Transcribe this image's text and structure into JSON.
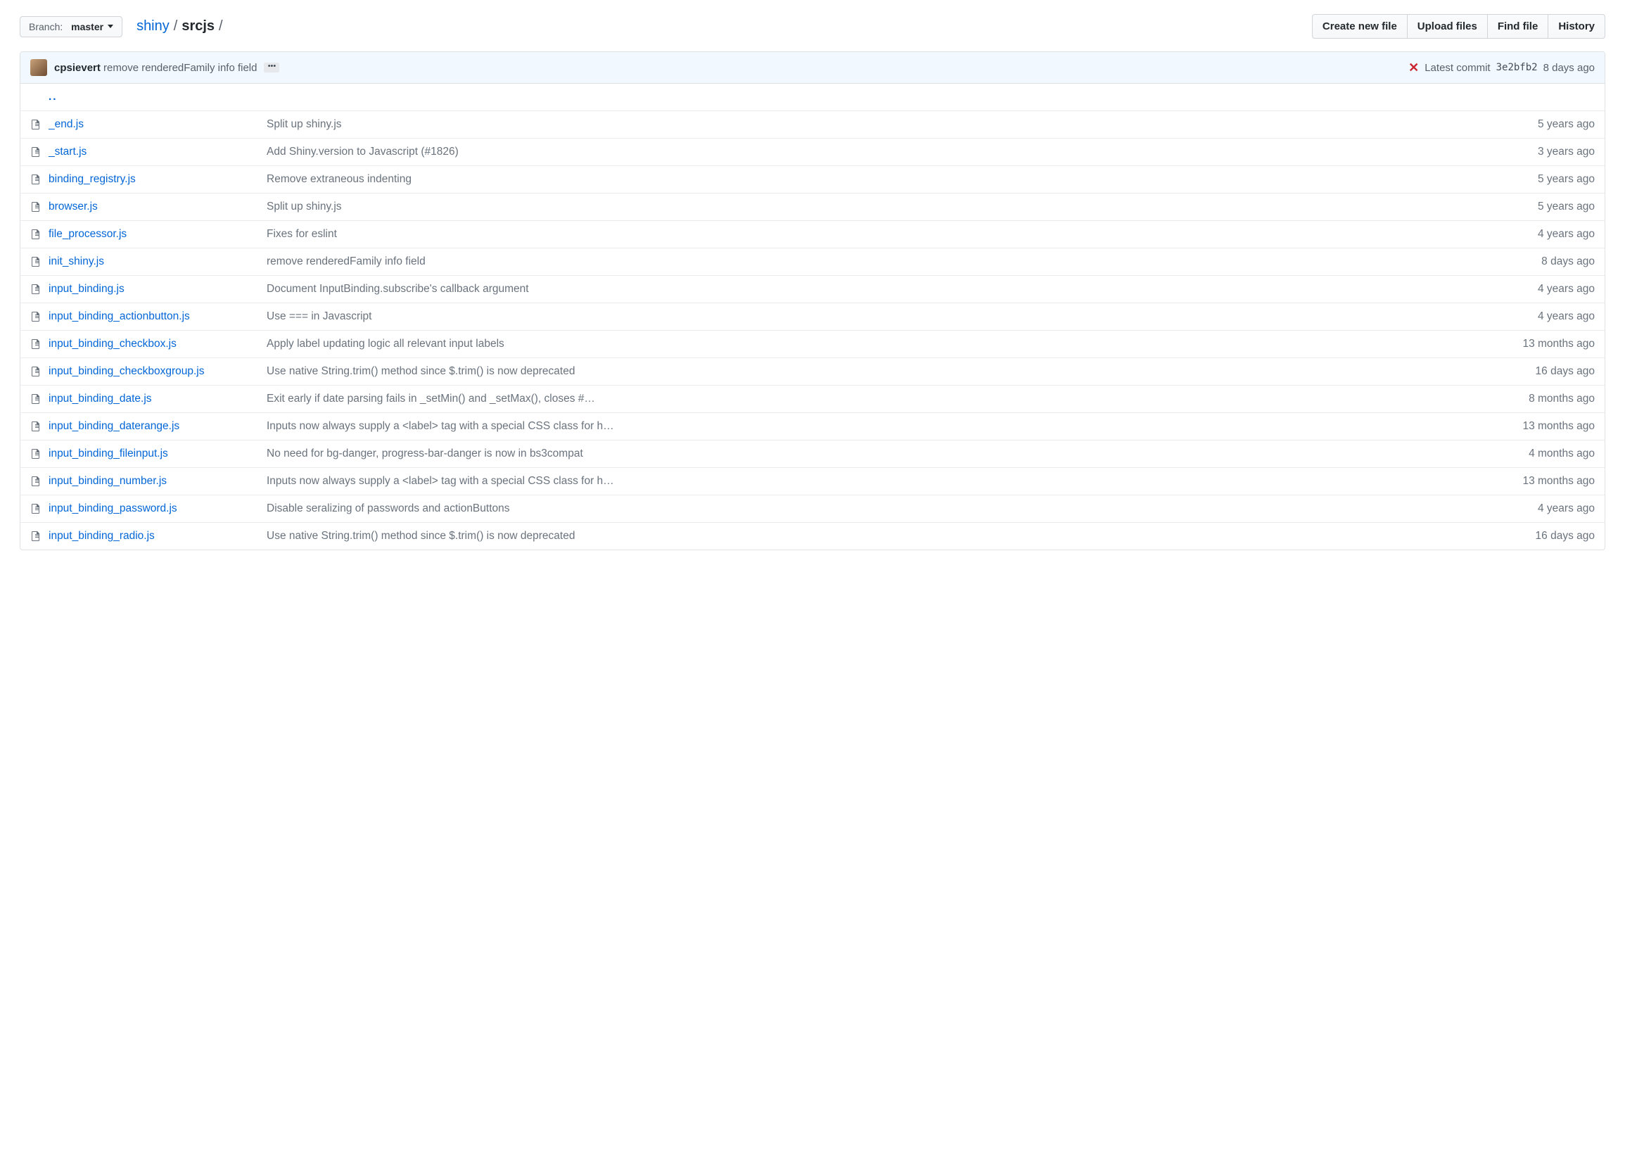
{
  "branch": {
    "label": "Branch:",
    "name": "master"
  },
  "breadcrumb": {
    "root": "shiny",
    "sep": "/",
    "current": "srcjs",
    "trail": "/"
  },
  "actions": {
    "create": "Create new file",
    "upload": "Upload files",
    "find": "Find file",
    "history": "History"
  },
  "commit_bar": {
    "author": "cpsievert",
    "message": "remove renderedFamily info field",
    "status": "failed",
    "latest_label": "Latest commit",
    "sha": "3e2bfb2",
    "age": "8 days ago"
  },
  "parent_link": "..",
  "files": [
    {
      "name": "_end.js",
      "msg": "Split up shiny.js",
      "age": "5 years ago"
    },
    {
      "name": "_start.js",
      "msg": "Add Shiny.version to Javascript (#1826)",
      "age": "3 years ago"
    },
    {
      "name": "binding_registry.js",
      "msg": "Remove extraneous indenting",
      "age": "5 years ago"
    },
    {
      "name": "browser.js",
      "msg": "Split up shiny.js",
      "age": "5 years ago"
    },
    {
      "name": "file_processor.js",
      "msg": "Fixes for eslint",
      "age": "4 years ago"
    },
    {
      "name": "init_shiny.js",
      "msg": "remove renderedFamily info field",
      "age": "8 days ago"
    },
    {
      "name": "input_binding.js",
      "msg": "Document InputBinding.subscribe's callback argument",
      "age": "4 years ago"
    },
    {
      "name": "input_binding_actionbutton.js",
      "msg": "Use === in Javascript",
      "age": "4 years ago"
    },
    {
      "name": "input_binding_checkbox.js",
      "msg": "Apply label updating logic all relevant input labels",
      "age": "13 months ago"
    },
    {
      "name": "input_binding_checkboxgroup.js",
      "msg": "Use native String.trim() method since $.trim() is now deprecated",
      "age": "16 days ago"
    },
    {
      "name": "input_binding_date.js",
      "msg": "Exit early if date parsing fails in _setMin() and _setMax(), closes #…",
      "msg_truncated": true,
      "age": "8 months ago"
    },
    {
      "name": "input_binding_daterange.js",
      "msg": "Inputs now always supply a <label> tag with a special CSS class for h…",
      "msg_truncated": true,
      "age": "13 months ago"
    },
    {
      "name": "input_binding_fileinput.js",
      "msg": "No need for bg-danger, progress-bar-danger is now in bs3compat",
      "age": "4 months ago"
    },
    {
      "name": "input_binding_number.js",
      "msg": "Inputs now always supply a <label> tag with a special CSS class for h…",
      "msg_truncated": true,
      "age": "13 months ago"
    },
    {
      "name": "input_binding_password.js",
      "msg": "Disable seralizing of passwords and actionButtons",
      "age": "4 years ago"
    },
    {
      "name": "input_binding_radio.js",
      "msg": "Use native String.trim() method since $.trim() is now deprecated",
      "age": "16 days ago"
    }
  ]
}
